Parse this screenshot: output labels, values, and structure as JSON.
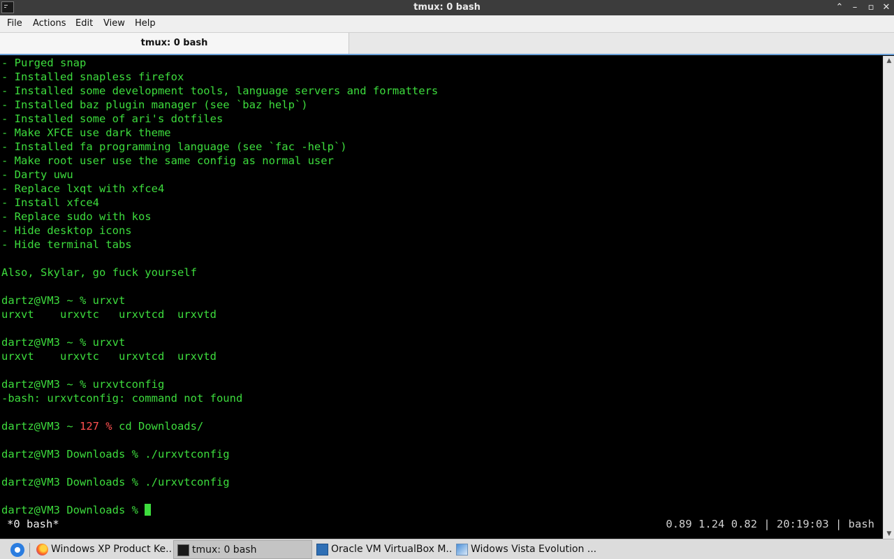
{
  "window": {
    "title": "tmux: 0 bash",
    "controls": {
      "minimize": "⌃",
      "restore": "–",
      "maximize": "▫",
      "close": "✕"
    }
  },
  "menu": [
    "File",
    "Actions",
    "Edit",
    "View",
    "Help"
  ],
  "tabs": [
    {
      "label": "tmux: 0 bash",
      "active": true
    }
  ],
  "terminal": {
    "lines": [
      "- Purged snap",
      "- Installed snapless firefox",
      "- Installed some development tools, language servers and formatters",
      "- Installed baz plugin manager (see `baz help`)",
      "- Installed some of ari's dotfiles",
      "- Make XFCE use dark theme",
      "- Installed fa programming language (see `fac -help`)",
      "- Make root user use the same config as normal user",
      "- Darty uwu",
      "- Replace lxqt with xfce4",
      "- Install xfce4",
      "- Replace sudo with kos",
      "- Hide desktop icons",
      "- Hide terminal tabs",
      "",
      "Also, Skylar, go fuck yourself",
      "",
      "dartz@VM3 ~ % urxvt",
      "urxvt    urxvtc   urxvtcd  urxvtd",
      "",
      "dartz@VM3 ~ % urxvt",
      "urxvt    urxvtc   urxvtcd  urxvtd",
      "",
      "dartz@VM3 ~ % urxvtconfig",
      "-bash: urxvtconfig: command not found",
      "",
      "",
      "",
      "dartz@VM3 Downloads % ./urxvtconfig",
      "",
      "dartz@VM3 Downloads % ./urxvtconfig",
      "",
      "dartz@VM3 Downloads % "
    ],
    "err_line": {
      "prefix": "dartz@VM3 ~ ",
      "code": "127 %",
      "command": " cd Downloads/"
    },
    "colors": {
      "text": "#3ddc3d",
      "error": "#ff5050",
      "background": "#000000"
    },
    "status_left": "*0 bash*",
    "status_right": "0.89 1.24 0.82 | 20:19:03 | bash"
  },
  "scrollbar": {
    "up": "▲",
    "down": "▼"
  },
  "taskbar": {
    "tasks": [
      {
        "label": "Windows XP Product Ke...",
        "icon": "firefox-icon",
        "active": false
      },
      {
        "label": "tmux: 0 bash",
        "icon": "terminal-icon",
        "active": true
      },
      {
        "label": "Oracle VM VirtualBox M...",
        "icon": "virtualbox-icon",
        "active": false
      },
      {
        "label": "Widows Vista Evolution ...",
        "icon": "vista-icon",
        "active": false
      }
    ]
  }
}
